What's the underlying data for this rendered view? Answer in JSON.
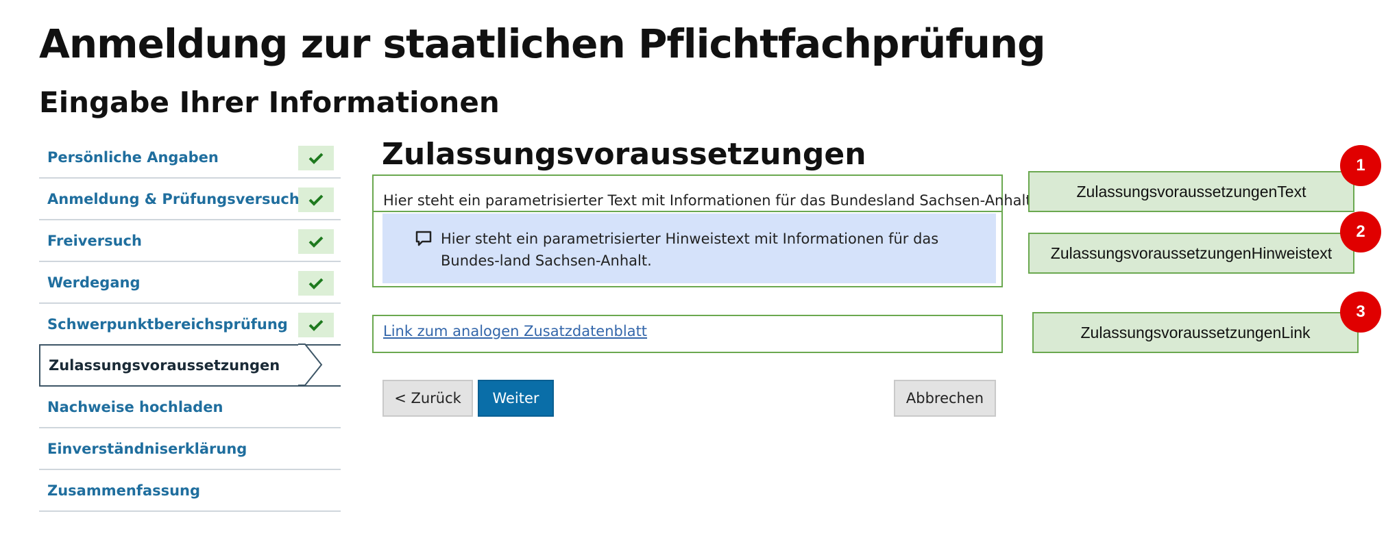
{
  "page": {
    "title": "Anmeldung zur staatlichen Pflichtfachprüfung",
    "subtitle": "Eingabe Ihrer Informationen"
  },
  "sidebar": {
    "items": [
      {
        "label": "Persönliche Angaben",
        "state": "done"
      },
      {
        "label": "Anmeldung & Prüfungsversuche",
        "state": "done"
      },
      {
        "label": "Freiversuch",
        "state": "done"
      },
      {
        "label": "Werdegang",
        "state": "done"
      },
      {
        "label": "Schwerpunktbereichsprüfung",
        "state": "done"
      },
      {
        "label": "Zulassungsvoraussetzungen",
        "state": "active"
      },
      {
        "label": "Nachweise hochladen",
        "state": "open"
      },
      {
        "label": "Einverständniserklärung",
        "state": "open"
      },
      {
        "label": "Zusammenfassung",
        "state": "open"
      }
    ]
  },
  "main": {
    "section_title": "Zulassungsvoraussetzungen",
    "info_text": "Hier steht ein parametrisierter Text mit Informationen für das Bundesland Sachsen-Anhalt.",
    "hint_text": "Hier steht ein parametrisierter Hinweistext mit Informationen für das Bundes-land Sachsen-Anhalt.",
    "link_text": "Link zum analogen Zusatzdatenblatt",
    "buttons": {
      "back": "< Zurück",
      "next": "Weiter",
      "cancel": "Abbrechen"
    }
  },
  "annotations": [
    {
      "number": "1",
      "label": "ZulassungsvoraussetzungenText"
    },
    {
      "number": "2",
      "label": "ZulassungsvoraussetzungenHinweistext"
    },
    {
      "number": "3",
      "label": "ZulassungsvoraussetzungenLink"
    }
  ],
  "colors": {
    "accent": "#0a6ea8",
    "nav_text": "#1f6e9e",
    "check_bg": "#dcefd6",
    "check": "#1e7a1e",
    "hint_bg": "#d5e2fa",
    "annotation_bg": "#d9ead3",
    "annotation_border": "#6aa84f",
    "badge": "#e00000"
  }
}
